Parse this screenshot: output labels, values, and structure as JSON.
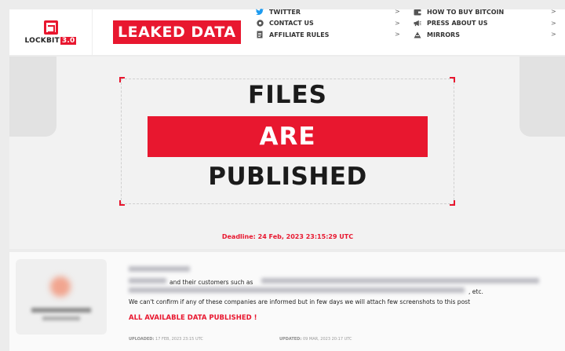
{
  "header": {
    "logo_text": "LOCKBIT",
    "logo_version": "3.0",
    "leaked_label": "LEAKED DATA",
    "nav_left": [
      {
        "icon": "twitter-icon",
        "label": "TWITTER"
      },
      {
        "icon": "contact-icon",
        "label": "CONTACT US"
      },
      {
        "icon": "document-icon",
        "label": "AFFILIATE RULES"
      }
    ],
    "nav_right": [
      {
        "icon": "wallet-icon",
        "label": "HOW TO BUY BITCOIN"
      },
      {
        "icon": "megaphone-icon",
        "label": "PRESS ABOUT US"
      },
      {
        "icon": "onion-icon",
        "label": "MIRRORS"
      }
    ],
    "chevron": ">"
  },
  "hero": {
    "line1": "FILES",
    "line2": "ARE",
    "line3": "PUBLISHED",
    "deadline": "Deadline: 24 Feb, 2023 23:15:29 UTC"
  },
  "post": {
    "line1_text": "and their customers such as",
    "line2_text": ", etc.",
    "line3_text": "We can't confirm if any of these companies are informed but in few days we will attach few screenshots to this post",
    "published_note": "ALL AVAILABLE DATA PUBLISHED !",
    "uploaded_label": "UPLOADED:",
    "uploaded_value": "17 FEB, 2023 23:15 UTC",
    "updated_label": "UPDATED:",
    "updated_value": "09 MAR, 2023 20:17 UTC"
  },
  "colors": {
    "accent": "#e8172f",
    "background": "#ececec",
    "text": "#1b1b1b"
  }
}
